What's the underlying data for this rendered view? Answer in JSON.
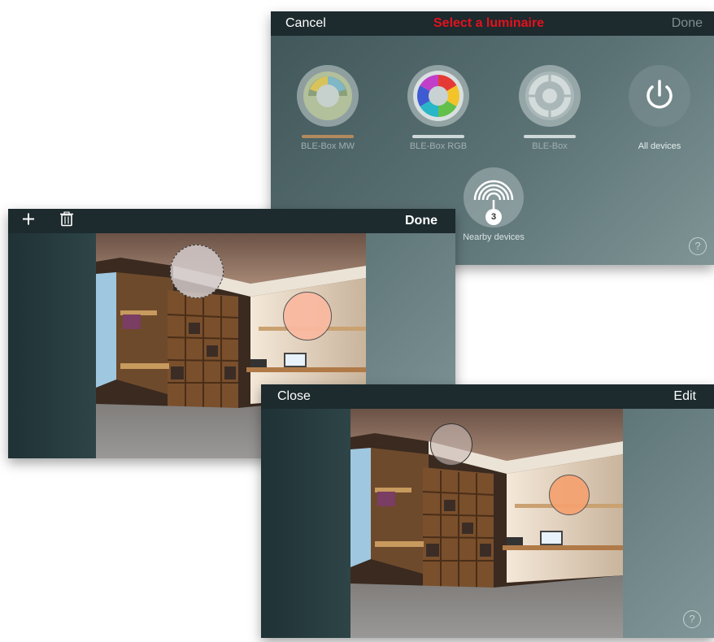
{
  "select_panel": {
    "cancel_label": "Cancel",
    "title": "Select a luminaire",
    "done_label": "Done",
    "devices": [
      {
        "label": "BLE-Box MW",
        "icon": "warm-dial-icon",
        "bar_color": "#b28a5e"
      },
      {
        "label": "BLE-Box RGB",
        "icon": "color-wheel-icon",
        "bar_color": "#cfd8d8"
      },
      {
        "label": "BLE-Box",
        "icon": "led-ring-icon",
        "bar_color": "#cfd8d8"
      },
      {
        "label": "All devices",
        "icon": "power-icon",
        "bar_color": null
      }
    ],
    "nearby": {
      "label": "Nearby devices",
      "count": "3",
      "icon": "nearby-signal-icon"
    },
    "help": "?",
    "title_color": "#e3121d"
  },
  "edit_panel": {
    "add_icon": "plus-icon",
    "delete_icon": "trash-icon",
    "done_label": "Done"
  },
  "view_panel": {
    "close_label": "Close",
    "edit_label": "Edit",
    "help": "?"
  }
}
